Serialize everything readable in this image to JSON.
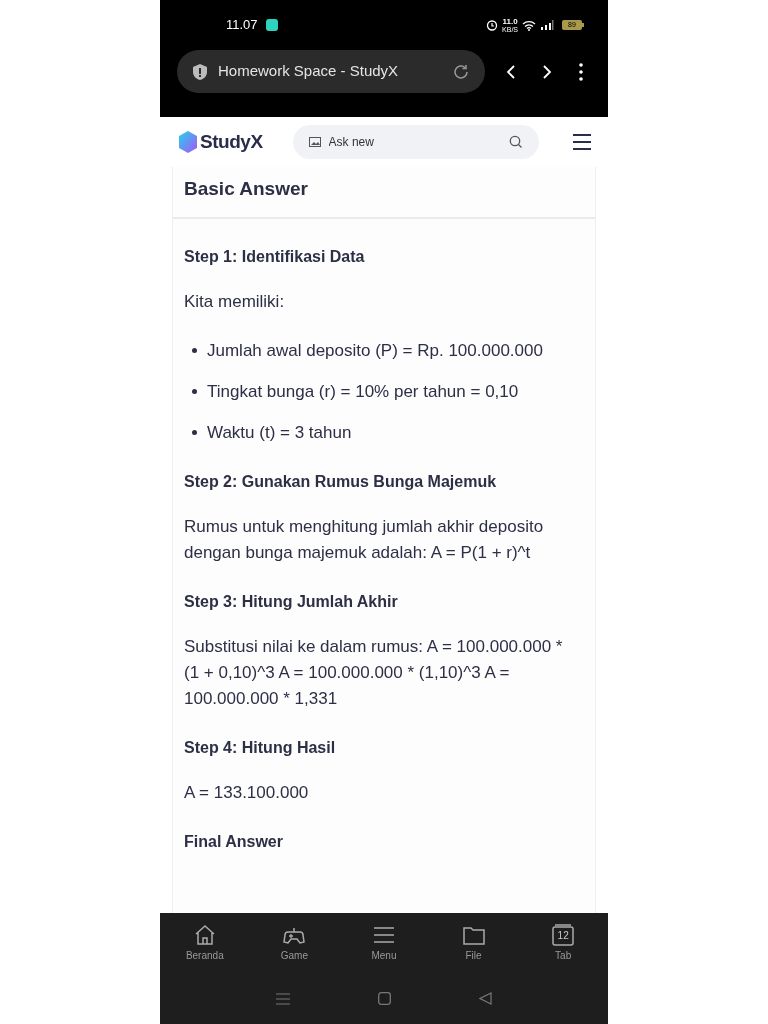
{
  "status_bar": {
    "time": "11.07",
    "net_speed": "11.0",
    "net_unit": "KB/S",
    "battery": "89"
  },
  "browser": {
    "title": "Homework Space - StudyX"
  },
  "site_header": {
    "logo": "StudyX",
    "search": {
      "placeholder": "Ask new"
    }
  },
  "answer": {
    "title": "Basic Answer",
    "blocks": [
      {
        "kind": "heading",
        "text": "Step 1: Identifikasi Data"
      },
      {
        "kind": "paragraph",
        "text": "Kita memiliki:"
      },
      {
        "kind": "bullets",
        "items": [
          "Jumlah awal deposito (P) = Rp. 100.000.000",
          "Tingkat bunga (r) = 10% per tahun = 0,10",
          "Waktu (t) = 3 tahun"
        ]
      },
      {
        "kind": "heading",
        "text": "Step 2: Gunakan Rumus Bunga Majemuk"
      },
      {
        "kind": "paragraph",
        "text": "Rumus untuk menghitung jumlah akhir deposito dengan bunga majemuk adalah: A = P(1 + r)^t"
      },
      {
        "kind": "heading",
        "text": "Step 3: Hitung Jumlah Akhir"
      },
      {
        "kind": "paragraph",
        "text": "Substitusi nilai ke dalam rumus: A = 100.000.000 * (1 + 0,10)^3 A = 100.000.000 * (1,10)^3 A = 100.000.000 * 1,331"
      },
      {
        "kind": "heading",
        "text": "Step 4: Hitung Hasil"
      },
      {
        "kind": "paragraph",
        "text": "A = 133.100.000"
      },
      {
        "kind": "heading",
        "text": "Final Answer"
      }
    ]
  },
  "bottom_nav": [
    {
      "kind": "home",
      "label": "Beranda"
    },
    {
      "kind": "game",
      "label": "Game"
    },
    {
      "kind": "menu",
      "label": "Menu"
    },
    {
      "kind": "file",
      "label": "File"
    },
    {
      "kind": "tabs",
      "label": "Tab",
      "count": "12"
    }
  ]
}
